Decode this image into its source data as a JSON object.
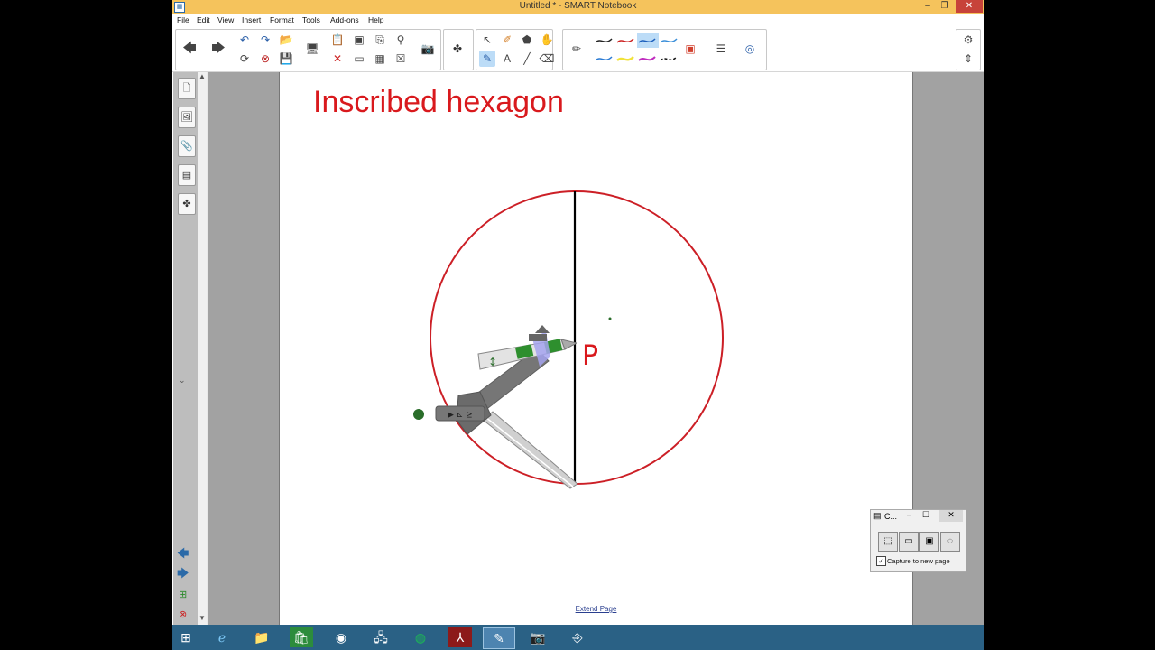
{
  "window": {
    "title": "Untitled * - SMART Notebook",
    "minimize_glyph": "–",
    "restore_glyph": "❐",
    "close_glyph": "✕",
    "app_icon": "smart-notebook-icon"
  },
  "menu": {
    "items": [
      "File",
      "Edit",
      "View",
      "Insert",
      "Format",
      "Tools",
      "Add-ons",
      "Help"
    ]
  },
  "toolbar": {
    "back": "🡄",
    "forward": "🡆",
    "undo": "↶",
    "redo": "↷",
    "open": "📂",
    "save": "💾",
    "delete": "✕",
    "screen_shade": "▭",
    "table": "▦",
    "close_table": "☒",
    "addons": "✤",
    "select": "↖",
    "pen_select": "✎",
    "text": "A",
    "line": "╱",
    "eraser": "⌫",
    "fill": "▣",
    "properties": "☰",
    "more": "◎",
    "settings": "⚙",
    "move_toolbar": "⇕"
  },
  "page": {
    "title": "Inscribed hexagon",
    "extend_link": "Extend Page",
    "point_label": "P"
  },
  "capture": {
    "title": "C...",
    "option": "Capture to new page",
    "checked": "✓"
  },
  "colors": {
    "title_red": "#d9191d",
    "circle_red": "#cc1f26",
    "window_title_bg": "#f5c35c",
    "taskbar_bg": "#2a6185"
  }
}
